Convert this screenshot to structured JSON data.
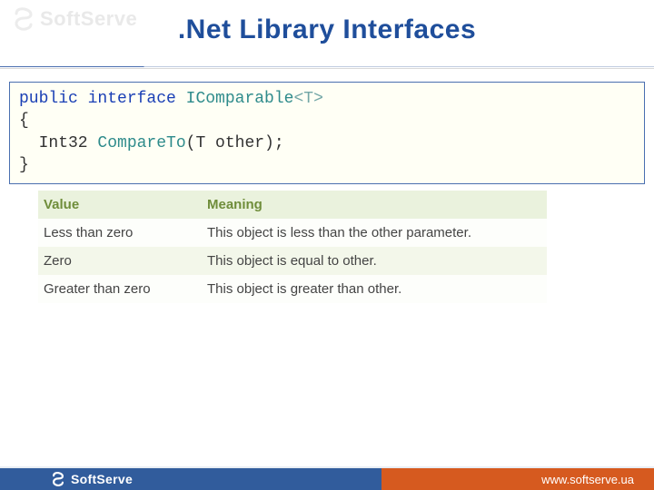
{
  "brand": "SoftServe",
  "title": ".Net Library Interfaces",
  "code": {
    "line1_kw": "public interface",
    "line1_type": "IComparable",
    "line1_gen": "<T>",
    "line2": "{",
    "line3_ret": "Int32",
    "line3_method": "CompareTo",
    "line3_rest": "(T other);",
    "line4": "}"
  },
  "table": {
    "headers": [
      "Value",
      "Meaning"
    ],
    "rows": [
      [
        "Less than zero",
        "This object is less than the other parameter."
      ],
      [
        "Zero",
        "This object is equal to other."
      ],
      [
        "Greater than zero",
        "This object is greater than other."
      ]
    ]
  },
  "footer_url": "www.softserve.ua"
}
